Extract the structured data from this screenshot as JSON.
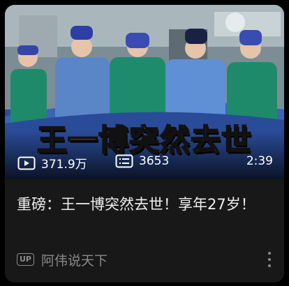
{
  "video": {
    "overlay_title": "王一博突然去世",
    "plays": "371.9万",
    "danmaku": "3653",
    "duration": "2:39",
    "title": "重磅：王一博突然去世！享年27岁！",
    "up_badge": "UP",
    "author": "阿伟说天下"
  },
  "icons": {
    "play": "play-count-icon",
    "danmaku": "danmaku-count-icon",
    "more": "more-options-icon"
  },
  "colors": {
    "card_background": "#181818",
    "overlay_title": "#ffe21a",
    "meta_text": "#8a8a8a",
    "title_text": "#f0f0f0"
  }
}
